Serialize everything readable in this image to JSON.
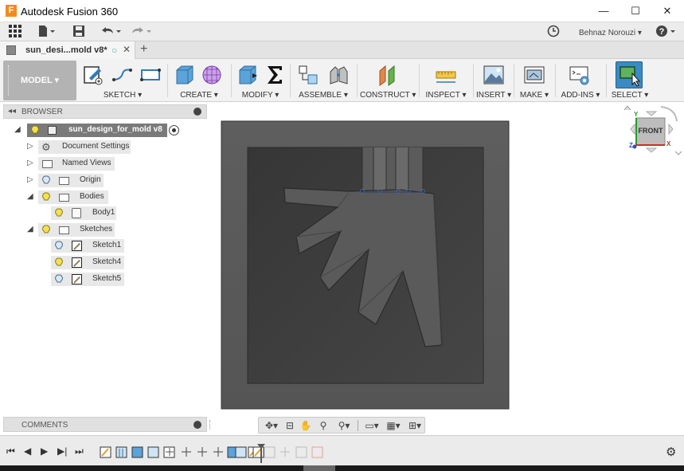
{
  "window": {
    "app_title": "Autodesk Fusion 360",
    "logo_letter": "F",
    "minimize": "—",
    "maximize": "☐",
    "close": "✕"
  },
  "toprow": {
    "user_name": "Behnaz Norouzi ▾",
    "help": "?"
  },
  "tab": {
    "name": "sun_desi...mold v8*",
    "add": "+"
  },
  "ribbon": {
    "workspace": "MODEL ▾",
    "groups": {
      "sketch": "SKETCH ▾",
      "create": "CREATE ▾",
      "modify": "MODIFY ▾",
      "assemble": "ASSEMBLE ▾",
      "construct": "CONSTRUCT ▾",
      "inspect": "INSPECT ▾",
      "insert": "INSERT ▾",
      "make": "MAKE ▾",
      "addins": "ADD-INS ▾",
      "select": "SELECT ▾"
    }
  },
  "browser": {
    "title": "BROWSER",
    "root": "sun_design_for_mold v8",
    "items": {
      "document_settings": "Document Settings",
      "named_views": "Named Views",
      "origin": "Origin",
      "bodies": "Bodies",
      "body1": "Body1",
      "sketches": "Sketches",
      "sketch1": "Sketch1",
      "sketch4": "Sketch4",
      "sketch5": "Sketch5"
    }
  },
  "viewcube": {
    "face": "FRONT",
    "axis_x": "X",
    "axis_y": "Y",
    "axis_z": "Z"
  },
  "comments": {
    "title": "COMMENTS"
  },
  "colors": {
    "mold_outer": "#5a5a5a",
    "mold_inner": "#404040",
    "sun_shape": "#555555",
    "accent_blue": "#2f7bbd"
  }
}
